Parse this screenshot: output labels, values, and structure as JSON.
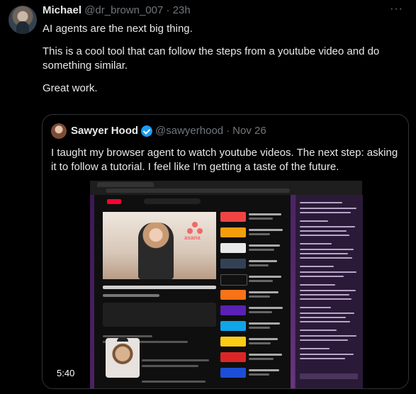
{
  "post": {
    "author_name": "Michael",
    "author_handle": "@dr_brown_007",
    "separator": "·",
    "age": "23h",
    "more_label": "···",
    "body": [
      "AI agents are the next big thing.",
      "This is a cool tool that can follow the steps from a youtube video and do something similar.",
      "Great work."
    ]
  },
  "quoted": {
    "author_name": "Sawyer Hood",
    "author_handle": "@sawyerhood",
    "separator": "·",
    "date": "Nov 26",
    "text": "I taught my browser agent to watch youtube videos. The next step: asking it to follow a tutorial. I feel like I'm getting a taste of the future.",
    "media": {
      "duration": "5:40",
      "video_brand": "asana"
    }
  },
  "colors": {
    "background": "#000000",
    "text": "#e7e9ea",
    "muted": "#71767b",
    "verified": "#1d9bf0",
    "border": "#2f3336"
  },
  "icons": {
    "verified": "verified-badge-icon",
    "more": "more-options-icon"
  }
}
